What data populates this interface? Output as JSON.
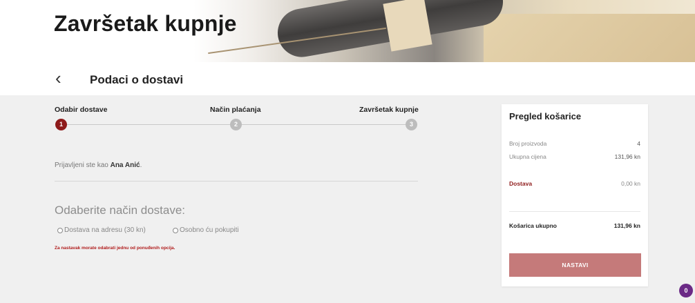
{
  "banner": {
    "title": "Završetak kupnje"
  },
  "subheader": {
    "back_icon": "chevron-left-icon",
    "title": "Podaci o dostavi"
  },
  "steps": [
    {
      "label": "Odabir dostave",
      "number": "1",
      "active": true
    },
    {
      "label": "Način plaćanja",
      "number": "2",
      "active": false
    },
    {
      "label": "Završetak kupnje",
      "number": "3",
      "active": false
    }
  ],
  "login": {
    "prefix": "Prijavljeni ste kao ",
    "user": "Ana Anić",
    "suffix": "."
  },
  "delivery": {
    "heading": "Odaberite način dostave:",
    "options": [
      "Dostava na adresu (30 kn)",
      "Osobno ću pokupiti"
    ],
    "error": "Za nastavak morate odabrati jednu od ponuđenih opcija."
  },
  "cart": {
    "title": "Pregled košarice",
    "count_label": "Broj proizvoda",
    "count_value": "4",
    "price_label": "Ukupna cijena",
    "price_value": "131,96 kn",
    "delivery_label": "Dostava",
    "delivery_value": "0,00 kn",
    "total_label": "Košarica ukupno",
    "total_value": "131,96 kn",
    "button": "NASTAVI"
  },
  "chat": {
    "count": "0"
  },
  "colors": {
    "accent": "#8e1b1b",
    "button": "#c57a7a",
    "chat": "#6b2a86"
  }
}
